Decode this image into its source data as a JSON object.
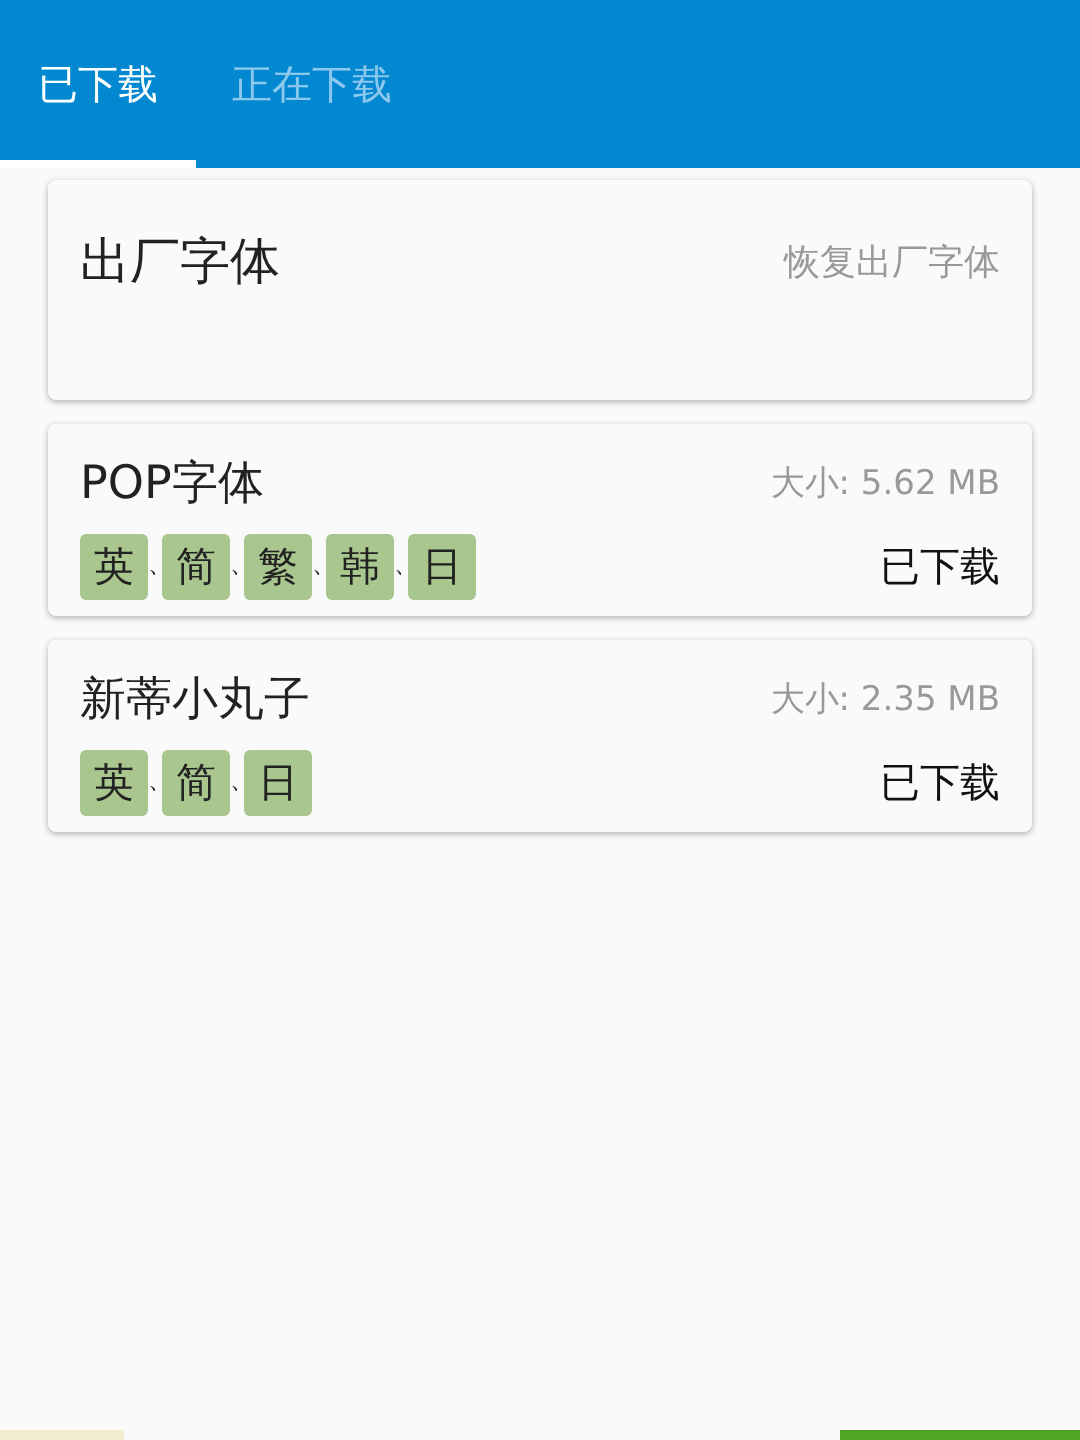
{
  "tabs": [
    {
      "label": "已下载",
      "selected": true
    },
    {
      "label": "正在下载",
      "selected": false
    }
  ],
  "fonts": [
    {
      "kind": "factory",
      "name": "出厂字体",
      "action": "恢复出厂字体"
    },
    {
      "kind": "download",
      "name": "POP字体",
      "size": "大小: 5.62 MB",
      "status": "已下载",
      "languages": [
        {
          "label": "英",
          "separator": "、"
        },
        {
          "label": "简",
          "separator": "、"
        },
        {
          "label": "繁",
          "separator": "、"
        },
        {
          "label": "韩",
          "separator": "、"
        },
        {
          "label": "日"
        }
      ]
    },
    {
      "kind": "download",
      "name": "新蒂小丸子",
      "size": "大小: 2.35 MB",
      "status": "已下载",
      "languages": [
        {
          "label": "英",
          "separator": "、"
        },
        {
          "label": "简",
          "separator": "、"
        },
        {
          "label": "日"
        }
      ]
    }
  ]
}
